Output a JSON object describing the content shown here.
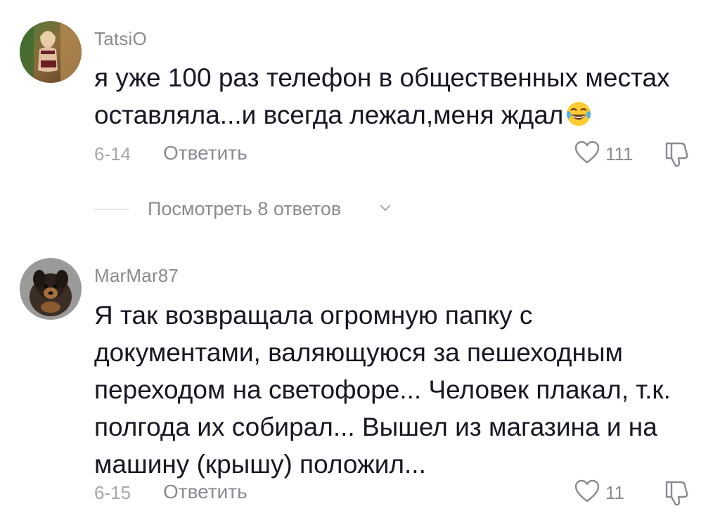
{
  "comments": [
    {
      "username": "TatsiO",
      "text": "я уже 100 раз телефон в общественных местах оставляла...и всегда лежал,меня ждал",
      "emoji": "face-with-tears-of-joy",
      "date": "6-14",
      "reply_label": "Ответить",
      "like_count": "111"
    },
    {
      "username": "MarMar87",
      "text": "Я так возвращала огромную папку с документами, валяющуюся за пешеходным переходом на светофоре... Человек плакал, т.к. полгода их собирал... Вышел из магазина и на машину (крышу) положил...",
      "date": "6-15",
      "reply_label": "Ответить",
      "like_count": "11"
    }
  ],
  "view_replies_label": "Посмотреть 8 ответов",
  "colors": {
    "text": "#161823",
    "secondary": "#8a8b91",
    "date": "#a7a8ac"
  },
  "icons": {
    "like": "heart-outline-icon",
    "dislike": "thumbs-down-outline-icon",
    "expand": "chevron-down-icon"
  }
}
